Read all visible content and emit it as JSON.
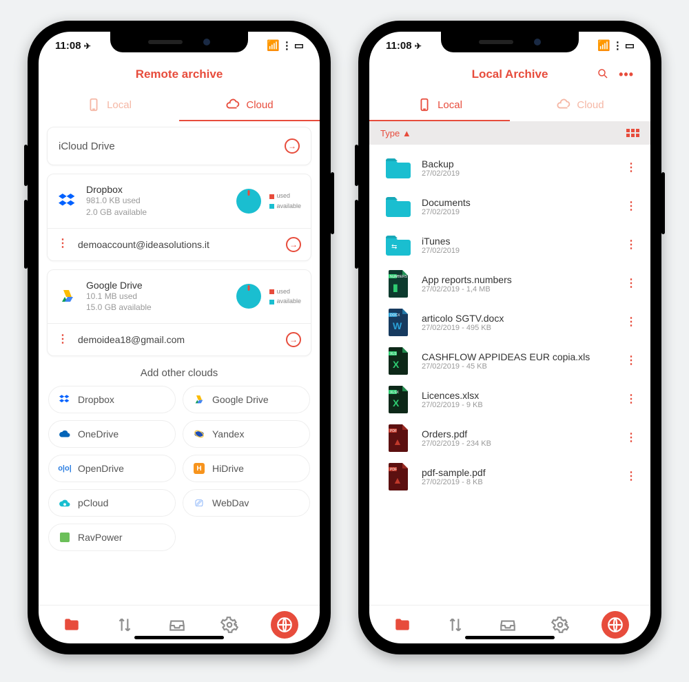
{
  "status": {
    "time": "11:08",
    "signal": "▪▪▫",
    "wifi": "⋮",
    "battery": "▭"
  },
  "phone1": {
    "title": "Remote archive",
    "tabs": {
      "local": "Local",
      "cloud": "Cloud",
      "active": "cloud"
    },
    "icloud": {
      "label": "iCloud Drive"
    },
    "services": [
      {
        "key": "dropbox",
        "name": "Dropbox",
        "used": "981.0 KB used",
        "avail": "2.0 GB available",
        "account": "demoaccount@ideasolutions.it"
      },
      {
        "key": "gdrive",
        "name": "Google Drive",
        "used": "10.1 MB used",
        "avail": "15.0 GB available",
        "account": "demoidea18@gmail.com"
      }
    ],
    "legend": {
      "used": "used",
      "available": "available"
    },
    "add_title": "Add other clouds",
    "add": [
      {
        "key": "dropbox",
        "label": "Dropbox"
      },
      {
        "key": "gdrive",
        "label": "Google Drive"
      },
      {
        "key": "onedrive",
        "label": "OneDrive"
      },
      {
        "key": "yandex",
        "label": "Yandex"
      },
      {
        "key": "opendrive",
        "label": "OpenDrive"
      },
      {
        "key": "hidrive",
        "label": "HiDrive"
      },
      {
        "key": "pcloud",
        "label": "pCloud"
      },
      {
        "key": "webdav",
        "label": "WebDav"
      },
      {
        "key": "ravpower",
        "label": "RavPower"
      }
    ]
  },
  "phone2": {
    "title": "Local Archive",
    "tabs": {
      "local": "Local",
      "cloud": "Cloud",
      "active": "local"
    },
    "sort": {
      "label": "Type",
      "dir": "▲"
    },
    "files": [
      {
        "type": "folder",
        "name": "Backup",
        "meta": "27/02/2019"
      },
      {
        "type": "folder",
        "name": "Documents",
        "meta": "27/02/2019"
      },
      {
        "type": "folder-usb",
        "name": "iTunes",
        "meta": "27/02/2019"
      },
      {
        "type": "numbers",
        "name": "App reports.numbers",
        "meta": "27/02/2019 - 1,4 MB"
      },
      {
        "type": "docx",
        "name": "articolo SGTV.docx",
        "meta": "27/02/2019 - 495 KB"
      },
      {
        "type": "xls",
        "name": "CASHFLOW APPIDEAS EUR copia.xls",
        "meta": "27/02/2019 - 45 KB"
      },
      {
        "type": "xlsx",
        "name": "Licences.xlsx",
        "meta": "27/02/2019 - 9 KB"
      },
      {
        "type": "pdf",
        "name": "Orders.pdf",
        "meta": "27/02/2019 - 234 KB"
      },
      {
        "type": "pdf",
        "name": "pdf-sample.pdf",
        "meta": "27/02/2019 - 8 KB"
      }
    ]
  },
  "colors": {
    "accent": "#e74c3c",
    "cyan": "#1abed0"
  }
}
